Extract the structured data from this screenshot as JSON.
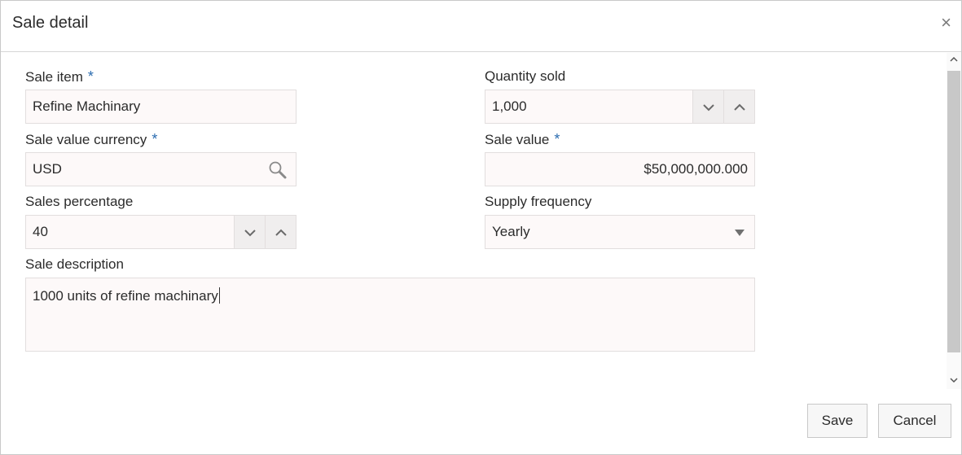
{
  "dialog": {
    "title": "Sale detail",
    "close_symbol": "×"
  },
  "form": {
    "sale_item": {
      "label": "Sale item",
      "required": "*",
      "value": "Refine Machinary"
    },
    "quantity_sold": {
      "label": "Quantity sold",
      "value": "1,000"
    },
    "sale_value_currency": {
      "label": "Sale value currency",
      "required": "*",
      "value": "USD"
    },
    "sale_value": {
      "label": "Sale value",
      "required": "*",
      "value": "$50,000,000.000"
    },
    "sales_percentage": {
      "label": "Sales percentage",
      "value": "40"
    },
    "supply_frequency": {
      "label": "Supply frequency",
      "value": "Yearly"
    },
    "sale_description": {
      "label": "Sale description",
      "value": "1000 units of refine machinary"
    }
  },
  "footer": {
    "save_label": "Save",
    "cancel_label": "Cancel"
  },
  "icons": {
    "search": "search-icon",
    "chevron_down": "chevron-down-icon",
    "chevron_up": "chevron-up-icon",
    "close": "close-icon",
    "dropdown": "caret-down-icon"
  },
  "colors": {
    "required": "#2b6cb0",
    "field_bg": "#fdf9f9"
  }
}
